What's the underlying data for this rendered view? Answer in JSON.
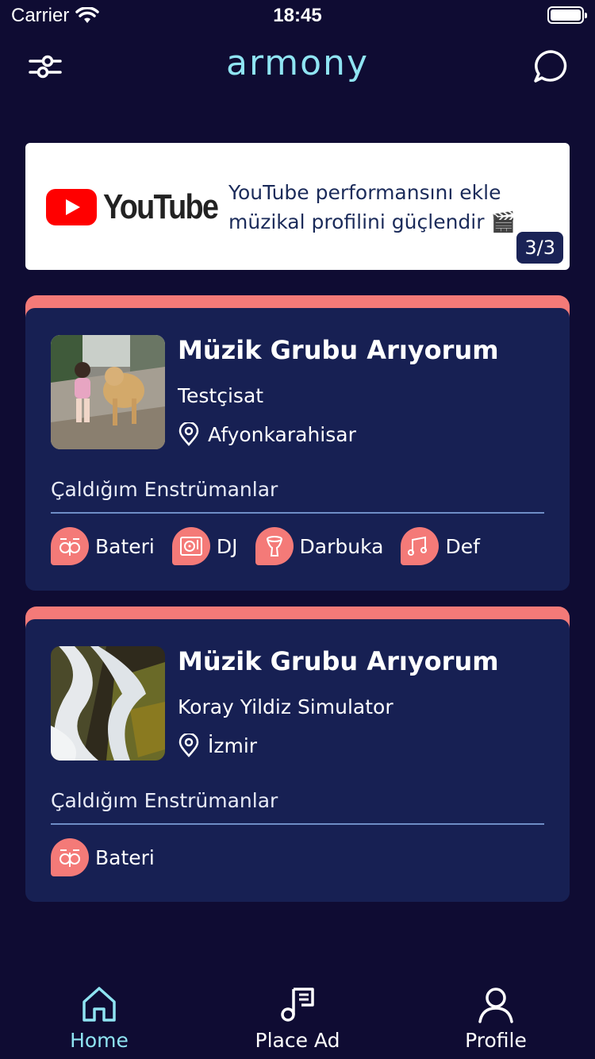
{
  "status_bar": {
    "carrier": "Carrier",
    "time": "18:45"
  },
  "header": {
    "brand": "armony",
    "filter_icon": "sliders-icon",
    "chat_icon": "chat-bubble-icon"
  },
  "banner": {
    "logo_text": "YouTube",
    "message": "YouTube performansını ekle müzikal profilini güçlendir 🎬",
    "counter": "3/3"
  },
  "cards": [
    {
      "title": "Müzik Grubu Arıyorum",
      "user": "Testçisat",
      "location": "Afyonkarahisar",
      "instruments_label": "Çaldığım Enstrümanlar",
      "instruments": [
        "Bateri",
        "DJ",
        "Darbuka",
        "Def"
      ],
      "thumbnail": "girl-and-dog-photo"
    },
    {
      "title": "Müzik Grubu Arıyorum",
      "user": "Koray Yildiz Simulator",
      "location": "İzmir",
      "instruments_label": "Çaldığım Enstrümanlar",
      "instruments": [
        "Bateri"
      ],
      "thumbnail": "waterfall-photo"
    }
  ],
  "tabs": [
    {
      "label": "Home",
      "icon": "home-icon",
      "active": true
    },
    {
      "label": "Place Ad",
      "icon": "music-note-icon",
      "active": false
    },
    {
      "label": "Profile",
      "icon": "user-icon",
      "active": false
    }
  ],
  "colors": {
    "background": "#0f0c33",
    "card": "#172053",
    "accent": "#f47a78",
    "brand": "#8fe4f2"
  }
}
